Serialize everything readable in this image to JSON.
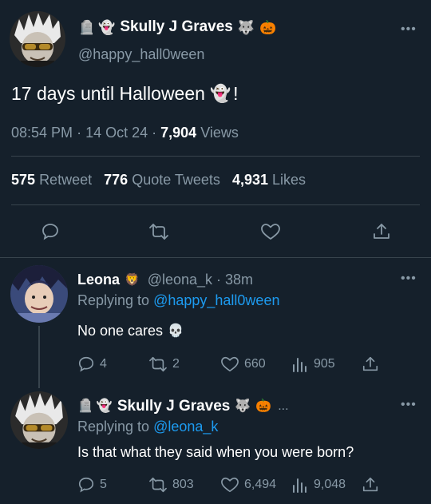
{
  "main_tweet": {
    "author": {
      "name": "Skully J Graves",
      "name_prefix_emojis": [
        "🪦",
        "👻"
      ],
      "name_suffix_emojis": [
        "🐺",
        "🎃"
      ],
      "handle": "@happy_hall0ween"
    },
    "text": "17 days until Halloween",
    "text_emoji": "👻",
    "text_end": "!",
    "time": "08:54 PM",
    "date": "14 Oct 24",
    "views_count": "7,904",
    "views_label": "Views",
    "stats": {
      "retweets_count": "575",
      "retweets_label": "Retweet",
      "quotes_count": "776",
      "quotes_label": "Quote Tweets",
      "likes_count": "4,931",
      "likes_label": "Likes"
    },
    "actions": [
      "reply-icon",
      "retweet-icon",
      "like-icon",
      "share-icon"
    ],
    "more": "•••"
  },
  "replies": [
    {
      "name": "Leona",
      "name_emoji": "🦁",
      "handle": "@leona_k",
      "time": "38m",
      "replying_to_label": "Replying to",
      "replying_to": "@happy_hall0ween",
      "text": "No one cares",
      "text_emoji": "💀",
      "replies": "4",
      "retweets": "2",
      "likes": "660",
      "views": "905",
      "more": "•••"
    },
    {
      "name": "Skully J Graves",
      "name_prefix_emojis": [
        "🪦",
        "👻"
      ],
      "name_suffix_emojis": [
        "🐺",
        "🎃"
      ],
      "truncation": "...",
      "replying_to_label": "Replying to",
      "replying_to": "@leona_k",
      "text": "Is that what they said when you were born?",
      "replies": "5",
      "retweets": "803",
      "likes": "6,494",
      "views": "9,048",
      "more": "•••"
    }
  ],
  "colors": {
    "background": "#15202b",
    "text": "#ffffff",
    "muted": "#8899a6",
    "link": "#1d9bf0",
    "divider": "#38444d"
  }
}
